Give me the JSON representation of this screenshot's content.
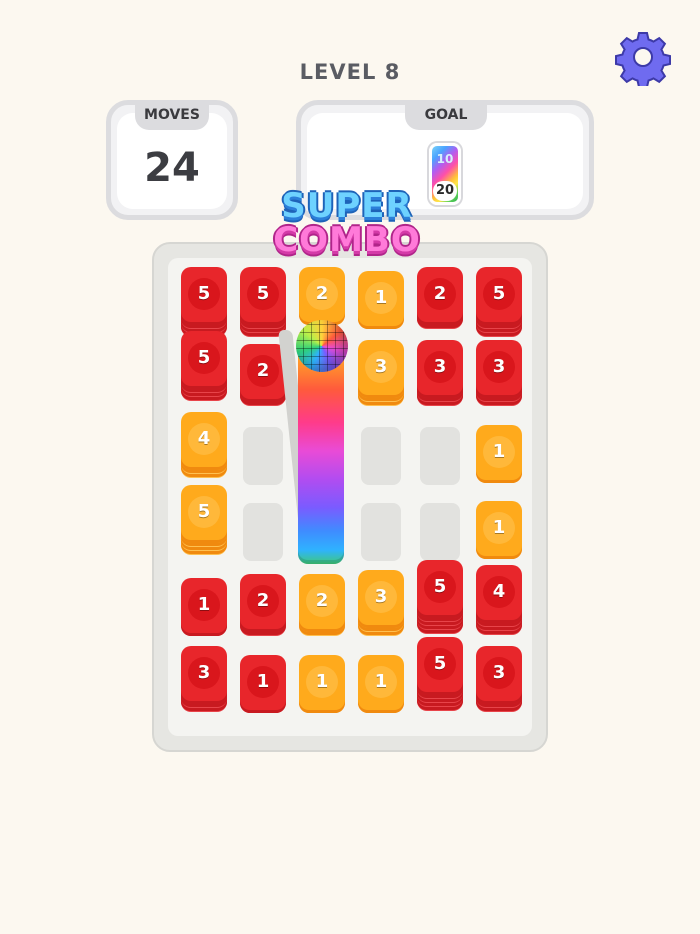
{
  "header": {
    "level_title": "LEVEL 8"
  },
  "moves_panel": {
    "label": "MOVES",
    "value": "24"
  },
  "goal_panel": {
    "label": "GOAL",
    "card_top_value": "10",
    "card_bottom_value": "20"
  },
  "combo_banner": {
    "line1": "SUPER",
    "line2": "COMBO"
  },
  "colors": {
    "red": "#e8262b",
    "orange": "#ffaa1c",
    "background": "#fcf8f0"
  },
  "icons": {
    "settings": "gear-icon"
  },
  "board": {
    "columns": 6,
    "stacks": [
      {
        "value": "5",
        "color": "red",
        "depth": 4
      },
      {
        "value": "5",
        "color": "red",
        "depth": 4
      },
      {
        "value": "2",
        "color": "orange",
        "depth": 1
      },
      {
        "value": "1",
        "color": "orange",
        "depth": 1
      },
      {
        "value": "2",
        "color": "red",
        "depth": 2
      },
      {
        "value": "5",
        "color": "red",
        "depth": 4
      },
      {
        "value": "5",
        "color": "red",
        "depth": 4
      },
      {
        "value": "2",
        "color": "red",
        "depth": 2
      },
      {
        "value": "3",
        "color": "orange",
        "depth": 3
      },
      {
        "value": "3",
        "color": "red",
        "depth": 3
      },
      {
        "value": "3",
        "color": "red",
        "depth": 3
      },
      {
        "value": "4",
        "color": "orange",
        "depth": 3
      },
      {
        "value": "1",
        "color": "orange",
        "depth": 1
      },
      {
        "value": "5",
        "color": "orange",
        "depth": 4
      },
      {
        "value": "1",
        "color": "orange",
        "depth": 1
      },
      {
        "value": "1",
        "color": "red",
        "depth": 1
      },
      {
        "value": "2",
        "color": "red",
        "depth": 2
      },
      {
        "value": "2",
        "color": "orange",
        "depth": 2
      },
      {
        "value": "3",
        "color": "orange",
        "depth": 3
      },
      {
        "value": "5",
        "color": "red",
        "depth": 5
      },
      {
        "value": "4",
        "color": "red",
        "depth": 4
      },
      {
        "value": "3",
        "color": "red",
        "depth": 3
      },
      {
        "value": "1",
        "color": "red",
        "depth": 1
      },
      {
        "value": "1",
        "color": "orange",
        "depth": 1
      },
      {
        "value": "1",
        "color": "orange",
        "depth": 1
      },
      {
        "value": "5",
        "color": "red",
        "depth": 5
      },
      {
        "value": "3",
        "color": "red",
        "depth": 3
      }
    ]
  }
}
